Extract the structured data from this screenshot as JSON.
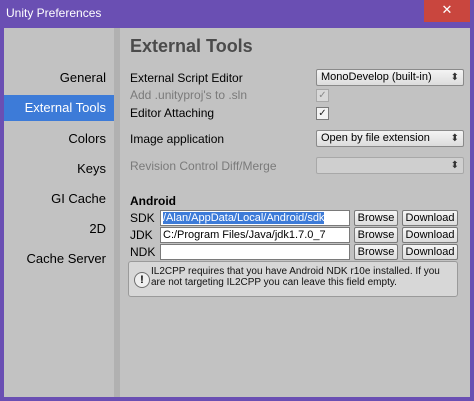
{
  "window": {
    "title": "Unity Preferences",
    "close_label": "✕",
    "accent_color": "#6a4fb3"
  },
  "sidebar": {
    "items": [
      {
        "label": "General",
        "selected": false
      },
      {
        "label": "External Tools",
        "selected": true
      },
      {
        "label": "Colors",
        "selected": false
      },
      {
        "label": "Keys",
        "selected": false
      },
      {
        "label": "GI Cache",
        "selected": false
      },
      {
        "label": "2D",
        "selected": false
      },
      {
        "label": "Cache Server",
        "selected": false
      }
    ]
  },
  "main": {
    "heading": "External Tools",
    "script_editor": {
      "label": "External Script Editor",
      "value": "MonoDevelop (built-in)"
    },
    "add_unityproj": {
      "label": "Add .unityproj's to .sln",
      "checked": true,
      "disabled": true
    },
    "editor_attaching": {
      "label": "Editor Attaching",
      "checked": true
    },
    "image_app": {
      "label": "Image application",
      "value": "Open by file extension"
    },
    "revision_control": {
      "label": "Revision Control Diff/Merge",
      "value": "",
      "disabled": true
    },
    "android": {
      "section_label": "Android",
      "sdk": {
        "label": "SDK",
        "path": "/Alan/AppData/Local/Android/sdk"
      },
      "jdk": {
        "label": "JDK",
        "path": "C:/Program Files/Java/jdk1.7.0_7"
      },
      "ndk": {
        "label": "NDK",
        "path": ""
      },
      "browse_label": "Browse",
      "download_label": "Download",
      "help_text": "IL2CPP requires that you have Android NDK r10e installed. If you are not targeting IL2CPP you can leave this field empty."
    }
  },
  "icons": {
    "check": "✓",
    "caret": "⬍",
    "info": "!"
  }
}
